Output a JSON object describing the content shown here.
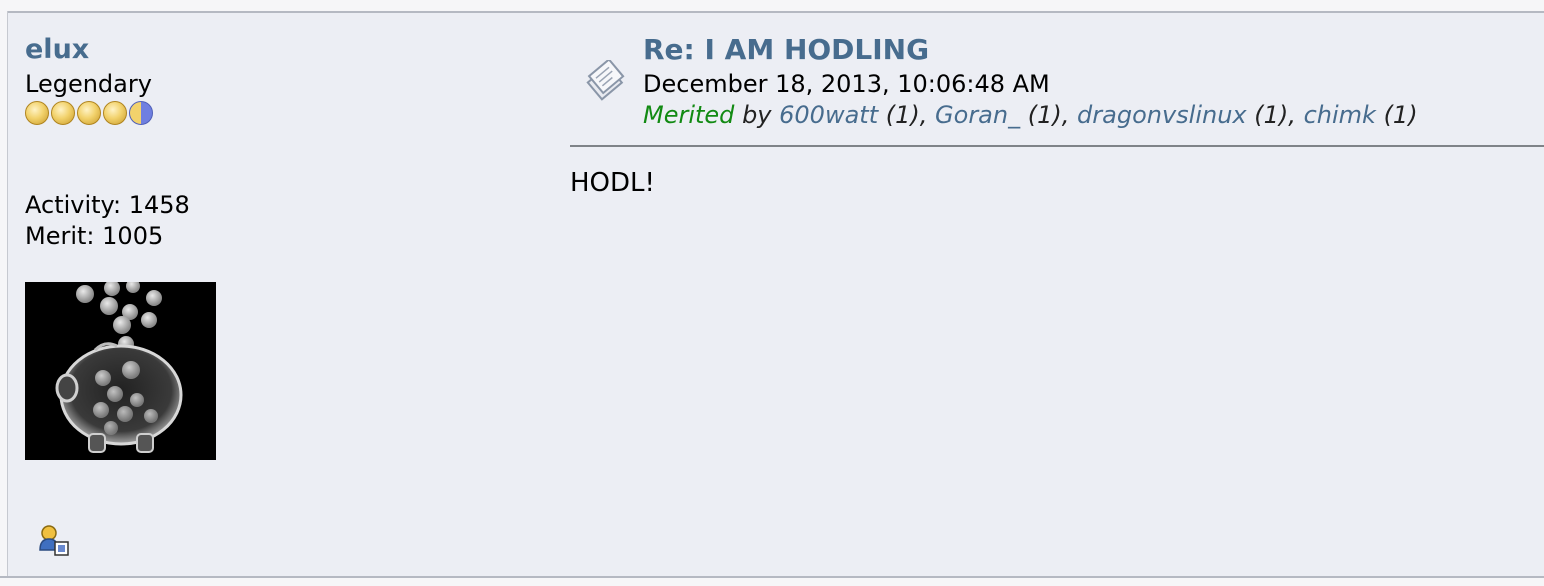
{
  "poster": {
    "name": "elux",
    "rank": "Legendary",
    "activity_label": "Activity:",
    "activity": "1458",
    "merit_label": "Merit:",
    "merit": "1005",
    "rank_stars": 4.5
  },
  "post": {
    "title": "Re: I AM HODLING",
    "date": "December 18, 2013, 10:06:48 AM",
    "merited_word": "Merited",
    "by_word": "by",
    "meriters": [
      {
        "name": "600watt",
        "count": "(1)"
      },
      {
        "name": "Goran_",
        "count": "(1)"
      },
      {
        "name": "dragonvslinux",
        "count": "(1)"
      },
      {
        "name": "chimk",
        "count": "(1)"
      }
    ],
    "body": "HODL!"
  },
  "icons": {
    "post_icon": "post-document-icon",
    "profile_icon": "user-profile-icon"
  },
  "colors": {
    "link": "#476c8e",
    "merited": "#128a13",
    "background": "#eceef4"
  }
}
